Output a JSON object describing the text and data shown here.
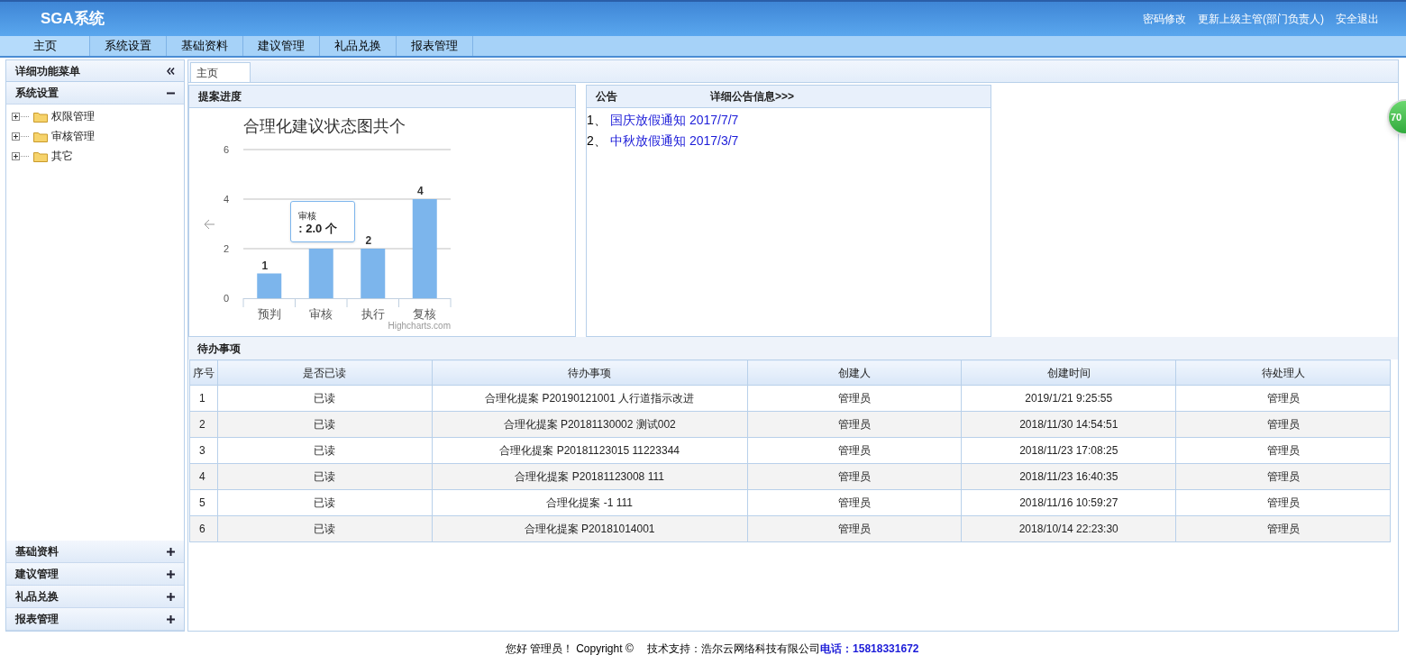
{
  "header": {
    "title": "SGA系统",
    "links": [
      "密码修改",
      "更新上级主管(部门负责人)",
      "安全退出"
    ]
  },
  "nav": [
    {
      "label": "主页",
      "selected": true
    },
    {
      "label": "系统设置",
      "selected": false
    },
    {
      "label": "基础资料",
      "selected": false
    },
    {
      "label": "建议管理",
      "selected": false
    },
    {
      "label": "礼品兑换",
      "selected": false
    },
    {
      "label": "报表管理",
      "selected": false
    }
  ],
  "sidebar": {
    "title": "详细功能菜单",
    "sections": [
      {
        "label": "系统设置",
        "expanded": true,
        "children": [
          {
            "label": "权限管理"
          },
          {
            "label": "审核管理"
          },
          {
            "label": "其它"
          }
        ]
      },
      {
        "label": "基础资料",
        "expanded": false
      },
      {
        "label": "建议管理",
        "expanded": false
      },
      {
        "label": "礼品兑换",
        "expanded": false
      },
      {
        "label": "报表管理",
        "expanded": false
      }
    ]
  },
  "tabs": [
    {
      "label": "主页",
      "selected": true
    }
  ],
  "progress_panel": {
    "title": "提案进度",
    "chart_data": {
      "type": "bar",
      "title": "合理化建议状态图共个",
      "categories": [
        "预判",
        "审核",
        "执行",
        "复核"
      ],
      "values": [
        1,
        2,
        2,
        4
      ],
      "ylim": [
        0,
        6
      ],
      "yticks": [
        0,
        2,
        4,
        6
      ],
      "value_labels": [
        "1",
        null,
        "2",
        "4"
      ]
    },
    "credit": "Highcharts.com",
    "tooltip": {
      "category": "审核",
      "value": ": 2.0 个"
    }
  },
  "notice_panel": {
    "title": "公告",
    "more_link": "详细公告信息>>>",
    "items": [
      {
        "index": "1、",
        "text": "国庆放假通知 2017/7/7"
      },
      {
        "index": "2、",
        "text": "中秋放假通知 2017/3/7"
      }
    ]
  },
  "todo_panel": {
    "title": "待办事项",
    "columns": [
      "序号",
      "是否已读",
      "待办事项",
      "创建人",
      "创建时间",
      "待处理人"
    ],
    "rows": [
      [
        "1",
        "已读",
        "合理化提案 P20190121001 人行道指示改进",
        "管理员",
        "2019/1/21 9:25:55",
        "管理员"
      ],
      [
        "2",
        "已读",
        "合理化提案 P20181130002 测试002",
        "管理员",
        "2018/11/30 14:54:51",
        "管理员"
      ],
      [
        "3",
        "已读",
        "合理化提案 P20181123015 11223344",
        "管理员",
        "2018/11/23 17:08:25",
        "管理员"
      ],
      [
        "4",
        "已读",
        "合理化提案 P20181123008 111",
        "管理员",
        "2018/11/23 16:40:35",
        "管理员"
      ],
      [
        "5",
        "已读",
        "合理化提案 -1 111",
        "管理员",
        "2018/11/16 10:59:27",
        "管理员"
      ],
      [
        "6",
        "已读",
        "合理化提案 P20181014001",
        "管理员",
        "2018/10/14 22:23:30",
        "管理员"
      ]
    ]
  },
  "floating_badge": "70",
  "footer": {
    "text": "您好 管理员！ Copyright ©　 技术支持：浩尔云网络科技有限公司",
    "phone": "电话：15818331672"
  }
}
